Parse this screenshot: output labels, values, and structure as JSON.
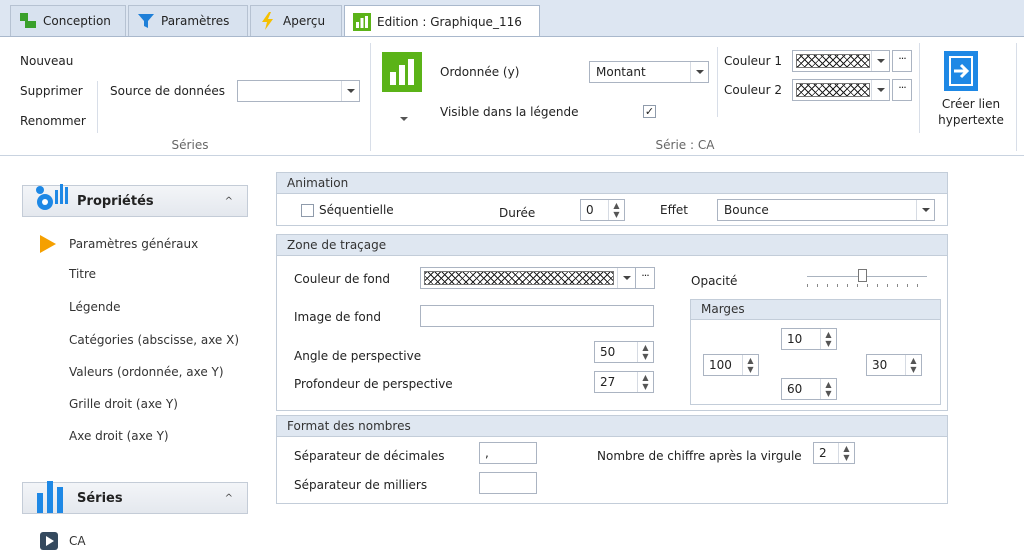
{
  "tabs": [
    {
      "label": "Conception"
    },
    {
      "label": "Paramètres"
    },
    {
      "label": "Aperçu"
    },
    {
      "label": "Edition : Graphique_116"
    }
  ],
  "ribbon": {
    "series_group": {
      "new_label": "Nouveau",
      "delete_label": "Supprimer",
      "rename_label": "Renommer",
      "datasource_label": "Source de données",
      "datasource_value": "",
      "group_title": "Séries"
    },
    "serie_group": {
      "ordinate_label": "Ordonnée (y)",
      "ordinate_value": "Montant",
      "visible_legend_label": "Visible dans la légende",
      "visible_legend_checked": "✓",
      "color1_label": "Couleur 1",
      "color2_label": "Couleur 2",
      "dots": "···",
      "hyperlink_label_1": "Créer lien",
      "hyperlink_label_2": "hypertexte",
      "group_title": "Série : CA"
    }
  },
  "left": {
    "props_header": "Propriétés",
    "items": [
      "Paramètres généraux",
      "Titre",
      "Légende",
      "Catégories (abscisse, axe X)",
      "Valeurs (ordonnée, axe Y)",
      "Grille droit (axe Y)",
      "Axe droit (axe Y)"
    ],
    "series_header": "Séries",
    "series_items": [
      "CA"
    ]
  },
  "animation": {
    "title": "Animation",
    "sequential_label": "Séquentielle",
    "duration_label": "Durée",
    "duration_value": "0",
    "effect_label": "Effet",
    "effect_value": "Bounce"
  },
  "plot_area": {
    "title": "Zone de traçage",
    "bgcolor_label": "Couleur de fond",
    "opacity_label": "Opacité",
    "bgimage_label": "Image de fond",
    "bgimage_value": "",
    "perspective_angle_label": "Angle de perspective",
    "perspective_angle_value": "50",
    "perspective_depth_label": "Profondeur de perspective",
    "perspective_depth_value": "27",
    "margins": {
      "title": "Marges",
      "top": "10",
      "left": "100",
      "right": "30",
      "bottom": "60"
    }
  },
  "number_format": {
    "title": "Format des nombres",
    "decimal_sep_label": "Séparateur de décimales",
    "decimal_sep_value": ",",
    "thousands_sep_label": "Séparateur de milliers",
    "thousands_sep_value": "",
    "digits_label": "Nombre de chiffre après la virgule",
    "digits_value": "2"
  },
  "spin_glyph": "▲\n▼",
  "colors": {
    "accent_green": "#5bb318",
    "accent_blue": "#1e88e5",
    "tab_bg": "#dde6f2",
    "section_header": "#dfe7f1",
    "play_orange": "#f5a000"
  }
}
